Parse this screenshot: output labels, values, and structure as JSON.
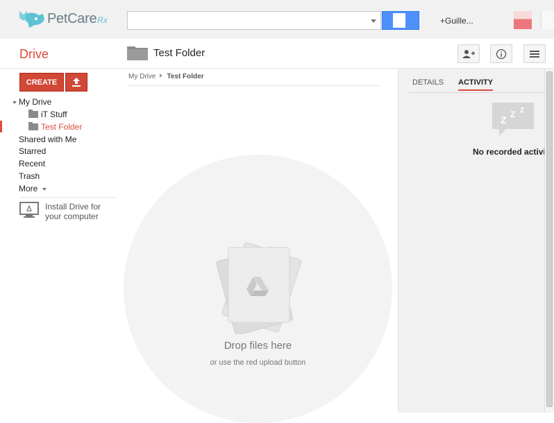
{
  "header": {
    "logo_text": "PetCare",
    "logo_suffix": "Rx",
    "search_placeholder": "",
    "user_name": "+Guille..."
  },
  "subheader": {
    "app_title": "Drive",
    "folder_title": "Test Folder"
  },
  "sidebar": {
    "create_label": "CREATE",
    "tree_root": "My Drive",
    "tree_children": [
      "iT Stuff",
      "Test Folder"
    ],
    "items": [
      "Shared with Me",
      "Starred",
      "Recent",
      "Trash",
      "More"
    ],
    "install_line1": "Install Drive for",
    "install_line2": "your computer"
  },
  "main": {
    "breadcrumb_root": "My Drive",
    "breadcrumb_current": "Test Folder",
    "drop_title": "Drop files here",
    "drop_subtitle": "or use the red upload button"
  },
  "details": {
    "tabs": [
      "DETAILS",
      "ACTIVITY"
    ],
    "active_tab": "ACTIVITY",
    "empty_message": "No recorded activity"
  },
  "colors": {
    "accent_red": "#dd4b39",
    "button_red": "#d14836",
    "search_blue": "#4d90fe"
  }
}
